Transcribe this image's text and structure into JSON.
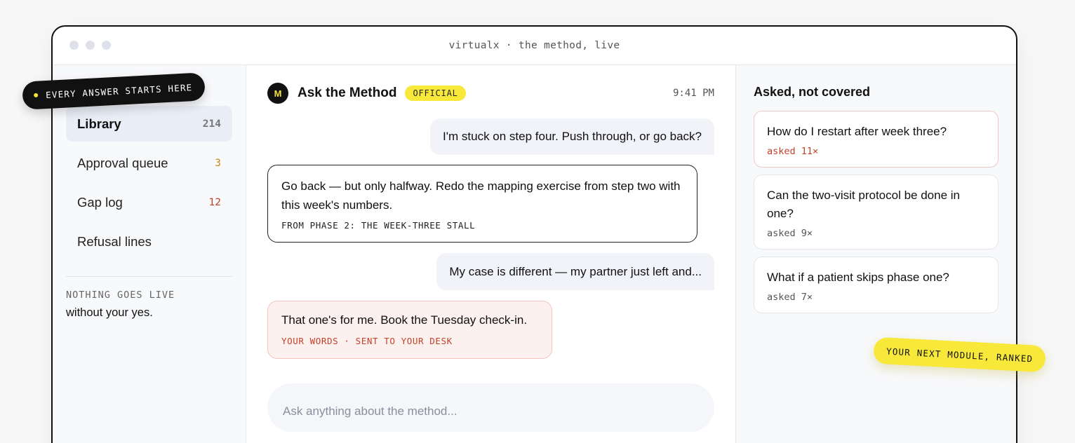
{
  "window": {
    "title": "virtualx · the method, live"
  },
  "stickers": {
    "left": "EVERY ANSWER STARTS HERE",
    "right": "YOUR NEXT MODULE, RANKED"
  },
  "sidebar": {
    "items": [
      {
        "label": "Library",
        "count": "214",
        "active": true
      },
      {
        "label": "Approval queue",
        "count": "3"
      },
      {
        "label": "Gap log",
        "count": "12"
      },
      {
        "label": "Refusal lines",
        "count": ""
      }
    ],
    "caption": "NOTHING GOES LIVE",
    "note": "without your yes."
  },
  "chat": {
    "avatar": "M",
    "title": "Ask the Method",
    "badge": "OFFICIAL",
    "time": "9:41 PM",
    "messages": {
      "user1": "I'm stuck on step four. Push through, or go back?",
      "bot1": "Go back — but only halfway. Redo the mapping exercise from step two with this week's numbers.",
      "bot1_source": "FROM PHASE 2: THE WEEK-THREE STALL",
      "user2": "My case is different — my partner just left and...",
      "refusal": "That one's for me. Book the Tuesday check-in.",
      "refusal_tag": "YOUR WORDS · SENT TO YOUR DESK"
    },
    "composer_placeholder": "Ask anything about the method..."
  },
  "gaps": {
    "title": "Asked, not covered",
    "items": [
      {
        "question": "How do I restart after week three?",
        "count": "asked 11×"
      },
      {
        "question": "Can the two-visit protocol be done in one?",
        "count": "asked 9×"
      },
      {
        "question": "What if a patient skips phase one?",
        "count": "asked 7×"
      }
    ]
  },
  "colors": {
    "accent": "#f7e83a",
    "alert": "#c2422a",
    "amber": "#c38a19",
    "ink": "#111111"
  }
}
